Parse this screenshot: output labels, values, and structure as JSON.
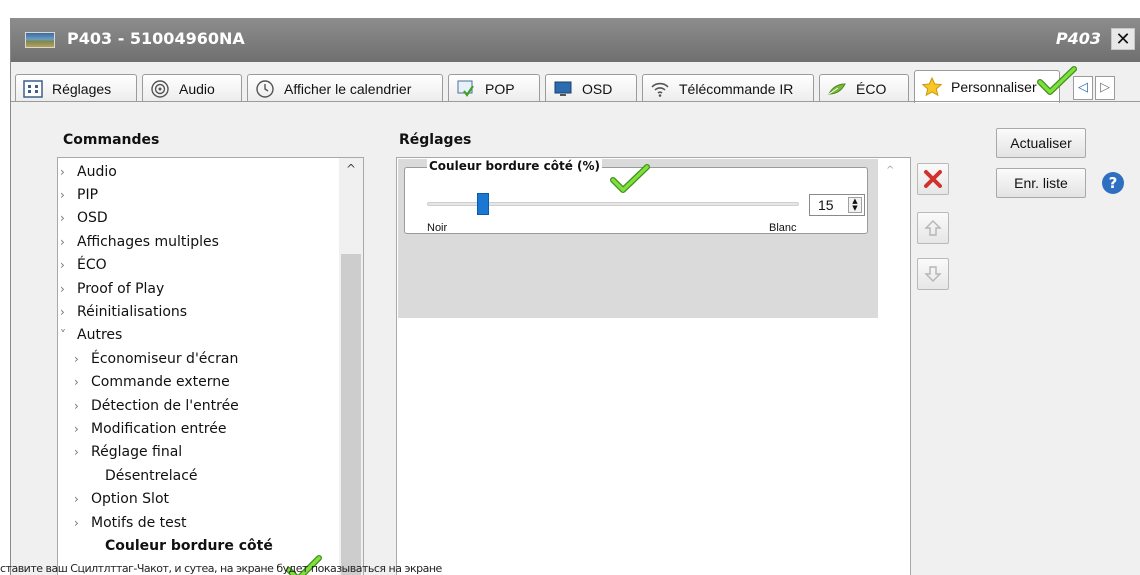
{
  "window": {
    "title": "P403 - 51004960NA",
    "model": "P403",
    "close_glyph": "✕"
  },
  "tabs": [
    {
      "label": "Réglages",
      "icon": "settings-grid-icon"
    },
    {
      "label": "Audio",
      "icon": "speaker-icon"
    },
    {
      "label": "Afficher le calendrier",
      "icon": "clock-icon"
    },
    {
      "label": "POP",
      "icon": "pop-icon"
    },
    {
      "label": "OSD",
      "icon": "monitor-icon"
    },
    {
      "label": "Télécommande IR",
      "icon": "wifi-icon"
    },
    {
      "label": "ÉCO",
      "icon": "leaf-icon"
    },
    {
      "label": "Personnaliser",
      "icon": "star-icon",
      "active": true
    }
  ],
  "commands": {
    "heading": "Commandes",
    "items": [
      {
        "label": "Audio",
        "arrow": "›"
      },
      {
        "label": "PIP",
        "arrow": "›"
      },
      {
        "label": "OSD",
        "arrow": "›"
      },
      {
        "label": "Affichages multiples",
        "arrow": "›"
      },
      {
        "label": "ÉCO",
        "arrow": "›"
      },
      {
        "label": "Proof of Play",
        "arrow": "›"
      },
      {
        "label": "Réinitialisations",
        "arrow": "›"
      },
      {
        "label": "Autres",
        "arrow": "˅"
      },
      {
        "label": "Économiseur d'écran",
        "arrow": "›"
      },
      {
        "label": "Commande externe",
        "arrow": "›"
      },
      {
        "label": "Détection de l'entrée",
        "arrow": "›"
      },
      {
        "label": "Modification entrée",
        "arrow": "›"
      },
      {
        "label": "Réglage final",
        "arrow": "›"
      },
      {
        "label": "Désentrelacé",
        "arrow": ""
      },
      {
        "label": "Option Slot",
        "arrow": "›"
      },
      {
        "label": "Motifs de test",
        "arrow": "›"
      },
      {
        "label": "Couleur bordure côté",
        "arrow": ""
      }
    ]
  },
  "settings": {
    "heading": "Réglages",
    "group_title": "Couleur bordure côté (%)",
    "slider_value": 15,
    "slider_min_label": "Noir",
    "slider_max_label": "Blanc",
    "spin_value": "15"
  },
  "buttons": {
    "refresh": "Actualiser",
    "save_list": "Enr. liste",
    "help": "?"
  },
  "colors": {
    "titlebar": "#7a7a7a",
    "slider_thumb": "#1a78d4",
    "delete_icon": "#d0322e",
    "checkmark": "#5fcf2a",
    "help_icon": "#2f6fc1"
  },
  "bottom_text": "ставите ваш Сцилтлттаг-Чакот, и сутеа, на экране будет показываться на экране"
}
